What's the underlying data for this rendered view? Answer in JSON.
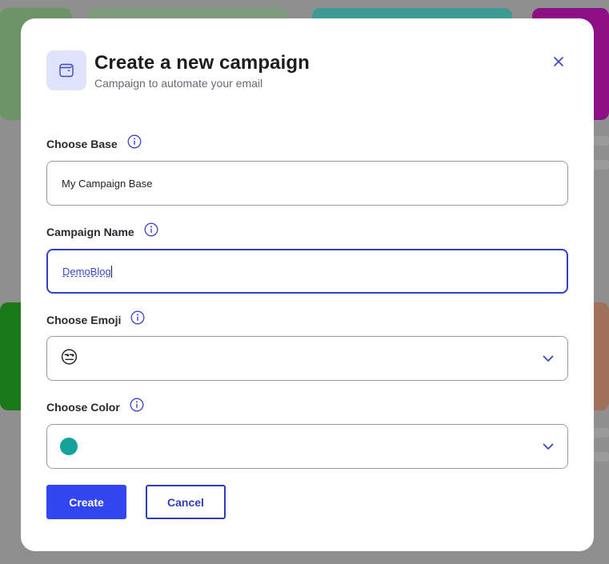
{
  "modal": {
    "title": "Create a new campaign",
    "subtitle": "Campaign to automate your email",
    "header_icon": "wallet-icon",
    "close_icon": "close-icon"
  },
  "fields": {
    "base": {
      "label": "Choose Base",
      "value": "My Campaign Base"
    },
    "name": {
      "label": "Campaign Name",
      "value": "DemoBlog"
    },
    "emoji": {
      "label": "Choose Emoji",
      "value": "😒"
    },
    "color": {
      "label": "Choose Color",
      "value": "#14a39b"
    }
  },
  "buttons": {
    "create": "Create",
    "cancel": "Cancel"
  },
  "colors": {
    "accent": "#3146ef",
    "accent_dark": "#2f3eb8",
    "icon_bg": "#dfe3fb"
  }
}
